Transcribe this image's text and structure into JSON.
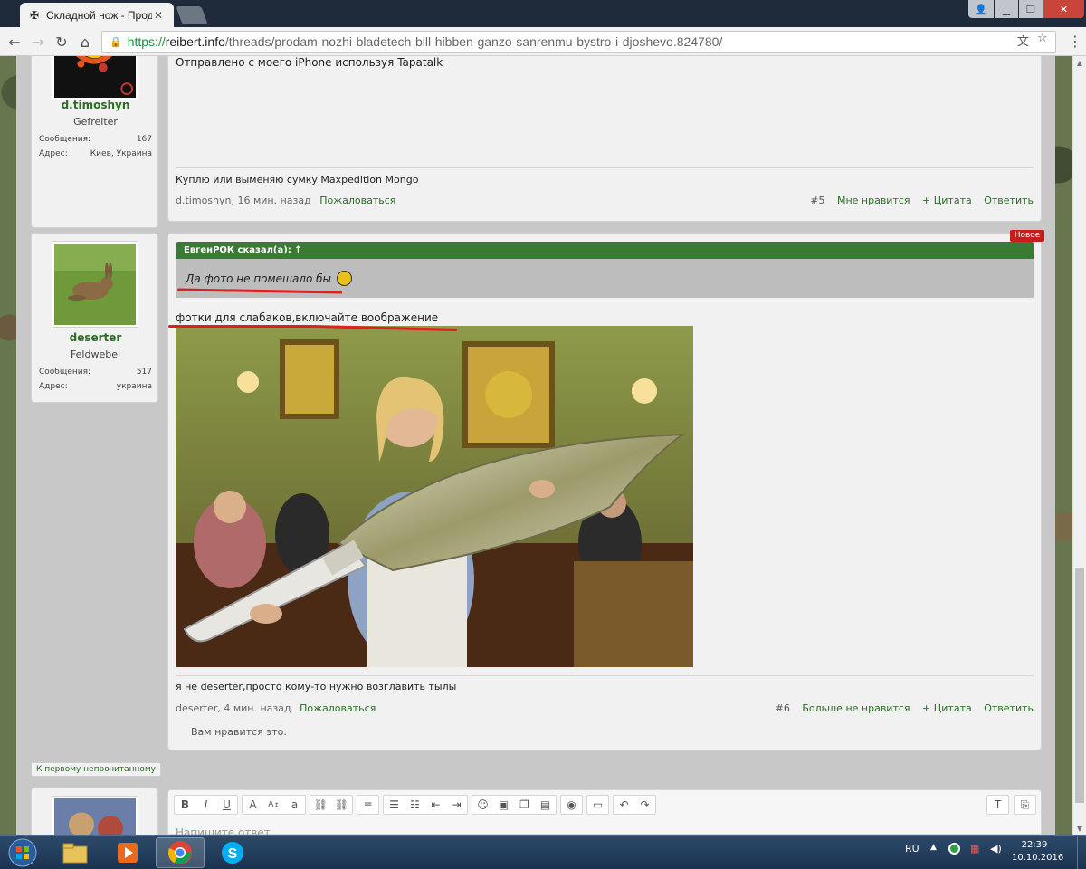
{
  "browser": {
    "tab_title": "Складной нож - Продаж",
    "url_scheme": "https://",
    "url_host": "reibert.info",
    "url_path": "/threads/prodam-nozhi-bladetech-bill-hibben-ganzo-sanrenmu-bystro-i-djoshevo.824780/"
  },
  "post5": {
    "username": "d.timoshyn",
    "rank": "Gefreiter",
    "messages_label": "Сообщения:",
    "messages_count": "167",
    "location_label": "Адрес:",
    "location": "Киев, Украина",
    "body": "Отправлено с моего iPhone используя Tapatalk",
    "signature": "Куплю или выменяю сумку Maxpedition Mongo",
    "author_time": "d.timoshyn, 16 мин. назад",
    "report": "Пожаловаться",
    "number": "#5",
    "like": "Мне нравится",
    "quote": "+ Цитата",
    "reply": "Ответить"
  },
  "post6": {
    "badge": "Новое",
    "username": "deserter",
    "rank": "Feldwebel",
    "messages_label": "Сообщения:",
    "messages_count": "517",
    "location_label": "Адрес:",
    "location": "украина",
    "quote_author": "ЕвгенРОК сказал(а): ↑",
    "quote_text": "Да фото не помешало бы",
    "body": "фотки для слабаков,включайте воображение",
    "signature": "я не deserter,просто кому-то нужно возглавить тылы",
    "author_time": "deserter, 4 мин. назад",
    "report": "Пожаловаться",
    "number": "#6",
    "like": "Больше не нравится",
    "quote": "+ Цитата",
    "reply": "Ответить",
    "liked_text": "Вам нравится это."
  },
  "unread_button": "К первому непрочитанному",
  "editor": {
    "placeholder": "Напишите ответ..."
  },
  "taskbar": {
    "language": "RU",
    "time": "22:39",
    "date": "10.10.2016"
  }
}
